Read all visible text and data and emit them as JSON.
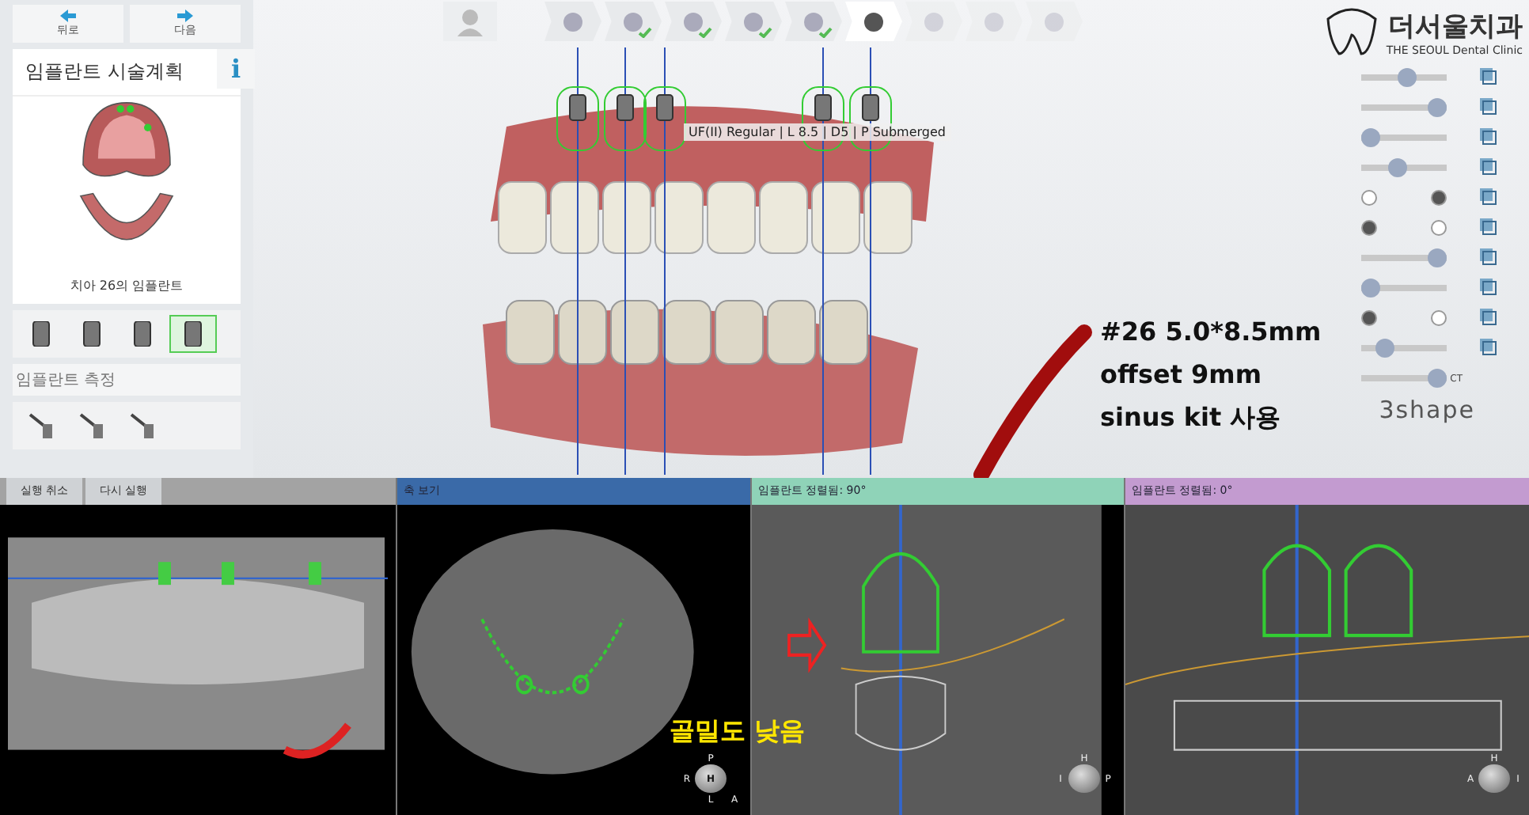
{
  "nav": {
    "back": "뒤로",
    "next": "다음"
  },
  "panel": {
    "title": "임플란트 시술계획",
    "info": "i",
    "caption": "치아 26의 임플란트"
  },
  "implant_tools": [
    {
      "selected": false
    },
    {
      "selected": false
    },
    {
      "selected": false
    },
    {
      "selected": true
    }
  ],
  "measure": {
    "title": "임플란트 측정",
    "tools": [
      {
        "selected": false
      },
      {
        "selected": false
      },
      {
        "selected": false
      }
    ]
  },
  "history": {
    "undo": "실행 취소",
    "redo": "다시 실행"
  },
  "steps": [
    {
      "done": false,
      "selected": false,
      "disabled": false
    },
    {
      "done": true,
      "selected": false,
      "disabled": false
    },
    {
      "done": true,
      "selected": false,
      "disabled": false
    },
    {
      "done": true,
      "selected": false,
      "disabled": false
    },
    {
      "done": true,
      "selected": false,
      "disabled": false
    },
    {
      "done": false,
      "selected": true,
      "disabled": false
    },
    {
      "done": false,
      "selected": false,
      "disabled": true
    },
    {
      "done": false,
      "selected": false,
      "disabled": true
    },
    {
      "done": false,
      "selected": false,
      "disabled": true
    }
  ],
  "tooltip": "UF(II) Regular | L 8.5 | D5 | P Submerged",
  "annotation": [
    "#26 5.0*8.5mm",
    "offset 9mm",
    "sinus kit 사용"
  ],
  "clinic": {
    "name": "더서울치과",
    "subtitle": "THE SEOUL Dental Clinic"
  },
  "layers": [
    {
      "kind": "slider",
      "level": 0.55
    },
    {
      "kind": "slider",
      "level": 1
    },
    {
      "kind": "slider",
      "level": 0
    },
    {
      "kind": "slider",
      "level": 0.4
    },
    {
      "kind": "toggle",
      "on": true
    },
    {
      "kind": "toggle",
      "on": false
    },
    {
      "kind": "slider",
      "level": 1
    },
    {
      "kind": "slider",
      "level": 0
    },
    {
      "kind": "toggle",
      "on": false
    },
    {
      "kind": "slider",
      "level": 0.2
    },
    {
      "kind": "slider",
      "level": 1,
      "label": "CT"
    }
  ],
  "brand": "3shape",
  "views": [
    {
      "kind": "panoramic",
      "color": "#a3a3a3"
    },
    {
      "kind": "axial",
      "title": "축 보기",
      "color": "#3a6aa8",
      "orientation": [
        "P",
        "R",
        "H",
        "L",
        "A"
      ]
    },
    {
      "kind": "cross",
      "title": "임플란트 정렬됨: 90°",
      "color": "#8fd3b8",
      "note": "골밀도 낮음",
      "orientation": [
        "H",
        "I",
        "P"
      ]
    },
    {
      "kind": "tangential",
      "title": "임플란트 정렬됨: 0°",
      "color": "#c39bd0",
      "orientation": [
        "H",
        "A",
        "I"
      ]
    }
  ]
}
